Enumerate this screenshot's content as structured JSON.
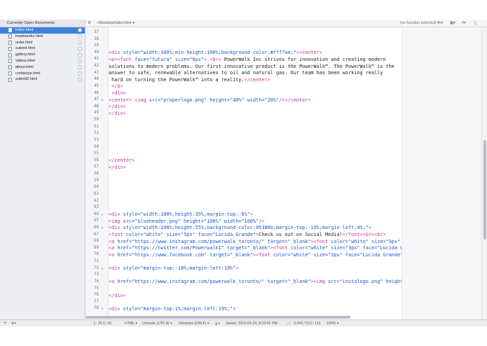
{
  "sidebar": {
    "title": "Currently Open Documents",
    "documents": [
      {
        "name": "index.html",
        "active": true
      },
      {
        "name": "howitworks.html",
        "active": false
      },
      {
        "name": "order.html",
        "active": false
      },
      {
        "name": "submit.html",
        "active": false
      },
      {
        "name": "gallery.html",
        "active": false
      },
      {
        "name": "videos.html",
        "active": false
      },
      {
        "name": "about.html",
        "active": false
      },
      {
        "name": "contactus.html",
        "active": false
      },
      {
        "name": "submit2.html",
        "active": false
      }
    ]
  },
  "topbar": {
    "gear": "⚙",
    "path": "~/Desktop/index.html ▾",
    "function_popup": "(no function selected) ▾",
    "icons": [
      "✎▾",
      "▦▾",
      "#▾",
      "◻"
    ]
  },
  "editor": {
    "lines": [
      {
        "n": "37",
        "fold": "",
        "segs": []
      },
      {
        "n": "38",
        "fold": "",
        "segs": []
      },
      {
        "n": "39",
        "fold": "",
        "segs": []
      },
      {
        "n": "40",
        "fold": "",
        "segs": [
          {
            "c": "t",
            "x": "<div "
          },
          {
            "c": "s",
            "x": "style=\"width:100%;min-height:100%;background-color:#fff7aa;\""
          },
          {
            "c": "t",
            "x": "><center>"
          }
        ]
      },
      {
        "n": "41",
        "fold": "",
        "segs": [
          {
            "c": "t",
            "x": "<p><font "
          },
          {
            "c": "s",
            "x": "face=\"futura\" size=\"6px\""
          },
          {
            "c": "t",
            "x": "> <br>"
          },
          {
            "c": "",
            "x": " PowerWalk Inc strives for innovation and creating modern"
          }
        ]
      },
      {
        "n": "42",
        "fold": "",
        "segs": [
          {
            "c": "",
            "x": "solutions to modern problems. Our first innovative product is the PowerWalk™. The PowerWalk™ is the"
          }
        ]
      },
      {
        "n": "43",
        "fold": "",
        "segs": [
          {
            "c": "",
            "x": "answer to safe, renewable alternatives to oil and natural gas. Our team has been working really"
          }
        ]
      },
      {
        "n": "44",
        "fold": "",
        "segs": [
          {
            "c": "",
            "x": " hard on turning the PowerWalk™ into a reality."
          },
          {
            "c": "t",
            "x": "</center>"
          }
        ]
      },
      {
        "n": "45",
        "fold": "",
        "segs": [
          {
            "c": "t",
            "x": " </p>"
          }
        ]
      },
      {
        "n": "46",
        "fold": "",
        "segs": [
          {
            "c": "t",
            "x": " <div>"
          }
        ]
      },
      {
        "n": "47",
        "fold": "▾",
        "segs": [
          {
            "c": "t",
            "x": "<center>"
          },
          {
            "c": "",
            "x": " "
          },
          {
            "c": "t",
            "x": "<img "
          },
          {
            "c": "s",
            "x": "src=\"properlogo.png\" height=\"40%\" width=\"20%\""
          },
          {
            "c": "t",
            "x": "/></center>"
          }
        ]
      },
      {
        "n": "48",
        "fold": "",
        "segs": [
          {
            "c": "t",
            "x": "</div>"
          }
        ]
      },
      {
        "n": "49",
        "fold": "",
        "segs": [
          {
            "c": "t",
            "x": "</div>"
          }
        ]
      },
      {
        "n": "50",
        "fold": "",
        "segs": []
      },
      {
        "n": "51",
        "fold": "",
        "segs": []
      },
      {
        "n": "52",
        "fold": "",
        "segs": []
      },
      {
        "n": "53",
        "fold": "",
        "segs": []
      },
      {
        "n": "54",
        "fold": "",
        "segs": []
      },
      {
        "n": "55",
        "fold": "",
        "segs": []
      },
      {
        "n": "56",
        "fold": "",
        "segs": [
          {
            "c": "t",
            "x": "</center>"
          }
        ]
      },
      {
        "n": "57",
        "fold": "",
        "segs": [
          {
            "c": "t",
            "x": "</div>"
          }
        ]
      },
      {
        "n": "58",
        "fold": "",
        "segs": []
      },
      {
        "n": "59",
        "fold": "",
        "segs": []
      },
      {
        "n": "60",
        "fold": "",
        "segs": []
      },
      {
        "n": "61",
        "fold": "",
        "segs": []
      },
      {
        "n": "62",
        "fold": "",
        "segs": []
      },
      {
        "n": "63",
        "fold": "",
        "segs": []
      },
      {
        "n": "64",
        "fold": "▾",
        "segs": [
          {
            "c": "t",
            "x": "<div "
          },
          {
            "c": "s",
            "x": "style=\"width:100%;height:35%;margin-top:-6%\""
          },
          {
            "c": "t",
            "x": ">"
          }
        ]
      },
      {
        "n": "65",
        "fold": "",
        "segs": [
          {
            "c": "t",
            "x": "<img "
          },
          {
            "c": "s",
            "x": "src=\"blueheader.png\" height=\"100%\" width=\"100%\""
          },
          {
            "c": "t",
            "x": "/>"
          }
        ]
      },
      {
        "n": "66",
        "fold": "▾",
        "segs": [
          {
            "c": "t",
            "x": "<div "
          },
          {
            "c": "s",
            "x": "style=\"width:100%;height:55%;background-color:05386b;margin-top:-19%;margin-left:4%;\""
          },
          {
            "c": "t",
            "x": ">"
          }
        ]
      },
      {
        "n": "67",
        "fold": "",
        "segs": [
          {
            "c": "t",
            "x": "<font "
          },
          {
            "c": "s",
            "x": "color=\"white\" size=\"5px\" face=\"Lucida Grande\""
          },
          {
            "c": "t",
            "x": ">"
          },
          {
            "c": "",
            "x": "Check us out on Social Media!"
          },
          {
            "c": "t",
            "x": "</font><br><br>"
          }
        ]
      },
      {
        "n": "68",
        "fold": "",
        "segs": [
          {
            "c": "t",
            "x": "<a "
          },
          {
            "c": "s",
            "x": "href=\"https://www.instagram.com/powerwalk_toronto/\" target=\"_blank\""
          },
          {
            "c": "t",
            "x": "><font "
          },
          {
            "c": "s",
            "x": "color=\"white\" size=\"3px\" face=\"Lucida"
          }
        ]
      },
      {
        "n": "69",
        "fold": "",
        "segs": [
          {
            "c": "t",
            "x": "<a "
          },
          {
            "c": "s",
            "x": "href=\"https://twitter.com/PowerwalkI\" target=\"_blank\""
          },
          {
            "c": "t",
            "x": "><font "
          },
          {
            "c": "s",
            "x": "color=\"white\" size=\"3px\" face=\"Lucida Grande\""
          },
          {
            "c": "t",
            "x": ">"
          },
          {
            "c": "",
            "x": "Twitte"
          }
        ]
      },
      {
        "n": "70",
        "fold": "",
        "segs": [
          {
            "c": "t",
            "x": "<a "
          },
          {
            "c": "s",
            "x": "href=\"https://www.facebook.com\" target=\"_blank\""
          },
          {
            "c": "t",
            "x": "><font "
          },
          {
            "c": "s",
            "x": "color=\"white\" size=\"3px\" face=\"Lucida Grande\""
          },
          {
            "c": "t",
            "x": ">"
          },
          {
            "c": "",
            "x": "Facebook: @"
          }
        ]
      },
      {
        "n": "71",
        "fold": "",
        "segs": []
      },
      {
        "n": "72",
        "fold": "▾",
        "segs": [
          {
            "c": "t",
            "x": "<div "
          },
          {
            "c": "s",
            "x": "style=\"margin-top:-18%;margin-left:19%\""
          },
          {
            "c": "t",
            "x": ">"
          }
        ]
      },
      {
        "n": "73",
        "fold": "",
        "segs": []
      },
      {
        "n": "74",
        "fold": "",
        "segs": [
          {
            "c": "t",
            "x": "<a "
          },
          {
            "c": "s",
            "x": "href=\"https://www.instagram.com/powerwalk_toronto/\" target=\"_blank\""
          },
          {
            "c": "t",
            "x": "><img "
          },
          {
            "c": "s",
            "x": "src=\"instalogo.png\" height=\"30%\" width"
          }
        ]
      },
      {
        "n": "75",
        "fold": "",
        "segs": []
      },
      {
        "n": "76",
        "fold": "",
        "segs": [
          {
            "c": "t",
            "x": "</div>"
          }
        ]
      },
      {
        "n": "77",
        "fold": "",
        "segs": []
      },
      {
        "n": "78",
        "fold": "▾",
        "segs": [
          {
            "c": "t",
            "x": "<div "
          },
          {
            "c": "s",
            "x": "style=\"margin-top:1%;margin-left:19%;\""
          },
          {
            "c": "t",
            "x": ">"
          }
        ]
      }
    ]
  },
  "statusbar": {
    "plus": "+",
    "gear": "⚙▾",
    "position": "L: 26 C: 61",
    "language": "HTML ▾",
    "encoding": "Unicode (UTF-8) ▾",
    "line_endings": "Windows (CRLF) ▾",
    "lock_icon": "🔒▾",
    "saved": "Saved: 2019-03-24, 8:23:41 PM",
    "doc_icon": "▭",
    "counts": "3,443 / 513 / 113",
    "zoom": "100% ▾"
  },
  "colors": {
    "tag": "#c7349c",
    "string": "#1b58c9",
    "selection": "#3d83dc"
  }
}
